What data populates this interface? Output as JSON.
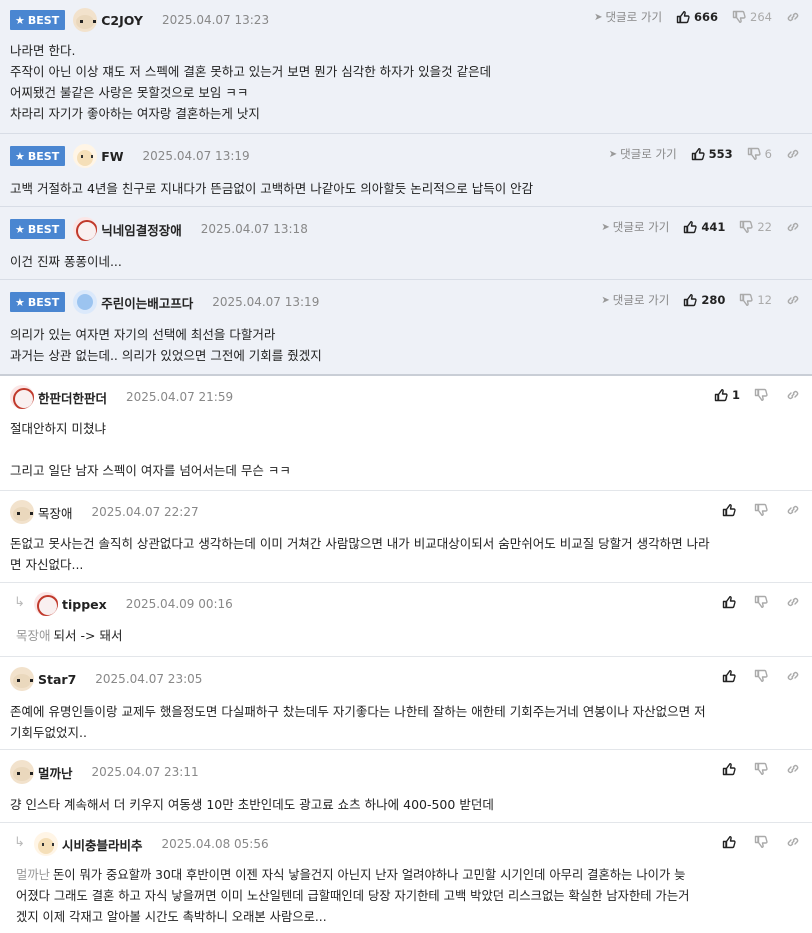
{
  "ui": {
    "best_label": "BEST",
    "goto_label": "댓글로 가기"
  },
  "comments": [
    {
      "nick": "C2JOY",
      "date": "2025.04.07 13:23",
      "up": "666",
      "down": "264",
      "lines": [
        "나라면 한다.",
        "주작이 아닌 이상 쟤도 저 스펙에 결혼 못하고 있는거 보면 뭔가 심각한 하자가 있을것 같은데",
        "어찌됐건 불같은 사랑은 못할것으로 보임 ㅋㅋ",
        "차라리 자기가 좋아하는 여자랑 결혼하는게 낫지"
      ]
    },
    {
      "nick": "FW",
      "date": "2025.04.07 13:19",
      "up": "553",
      "down": "6",
      "lines": [
        "고백 거절하고 4년을 친구로 지내다가 뜬금없이 고백하면 나같아도 의아할듯 논리적으로 납득이 안감"
      ]
    },
    {
      "nick": "닉네임결정장애",
      "date": "2025.04.07 13:18",
      "up": "441",
      "down": "22",
      "lines": [
        "이건 진짜 퐁퐁이네..."
      ]
    },
    {
      "nick": "주린이는배고프다",
      "date": "2025.04.07 13:19",
      "up": "280",
      "down": "12",
      "lines": [
        "의리가 있는 여자면 자기의 선택에 최선을 다할거라",
        "과거는 상관 없는데.. 의리가 있었으면 그전에 기회를 줬겠지"
      ]
    },
    {
      "nick": "한판더한판더",
      "date": "2025.04.07 21:59",
      "up": "1",
      "lines": [
        "절대안하지 미쳤냐",
        "",
        "그리고 일단 남자 스펙이 여자를 넘어서는데 무슨 ㅋㅋ"
      ]
    },
    {
      "nick": "목장애",
      "date": "2025.04.07 22:27",
      "lines": [
        "돈없고 못사는건 솔직히 상관없다고 생각하는데 이미 거쳐간 사람많으면 내가 비교대상이되서 숨만쉬어도 비교질 당할거 생각하면 나라",
        "면 자신없다..."
      ]
    },
    {
      "nick": "tippex",
      "date": "2025.04.09 00:16",
      "mention": "목장애",
      "lines": [
        "되서 -> 돼서"
      ]
    },
    {
      "nick": "Star7",
      "date": "2025.04.07 23:05",
      "lines": [
        "존예에 유명인들이랑 교제두 했을정도면 다실패하구 찼는데두 자기좋다는 나한테 잘하는 애한테 기회주는거네 연봉이나 자산없으면 저",
        "기회두없었지.."
      ]
    },
    {
      "nick": "멀까난",
      "date": "2025.04.07 23:11",
      "lines": [
        "걍 인스타 계속해서 더 키우지 여동생 10만 초반인데도 광고료 쇼츠 하나에 400-500 받던데"
      ]
    },
    {
      "nick": "시비충블라비추",
      "date": "2025.04.08 05:56",
      "mention": "멀까난",
      "lines": [
        "돈이 뭐가 중요할까 30대 후반이면 이젠 자식 낳을건지 아닌지 난자 얼려야하나 고민할 시기인데 아무리 결혼하는 나이가 늦",
        "어졌다 그래도 결혼 하고 자식 낳을꺼면 이미 노산일텐데 급할때인데 당장 자기한테 고백 박았던 리스크없는 확실한 남자한테 가는거",
        "겠지 이제 각재고 알아볼 시간도 촉박하니 오래본 사람으로..."
      ]
    }
  ]
}
